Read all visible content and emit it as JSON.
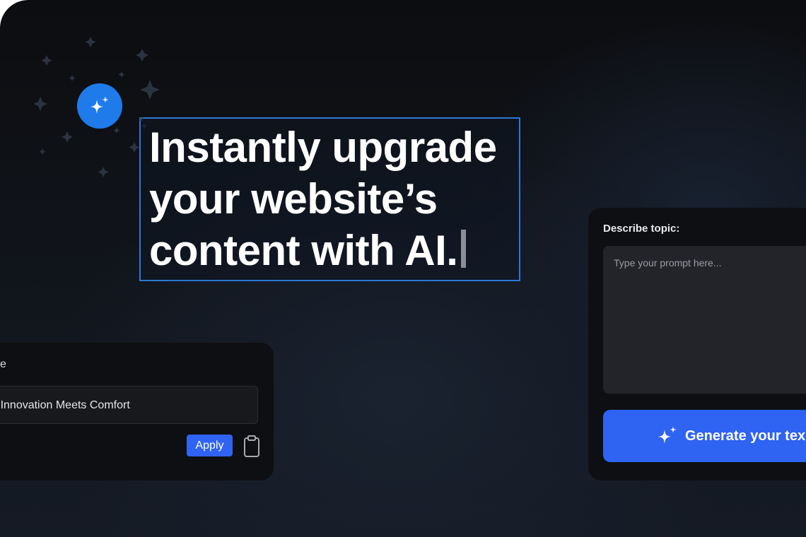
{
  "hero": {
    "headline_line1": "Instantly upgrade",
    "headline_line2": "your website’s",
    "headline_line3": "content with AI.",
    "badge_icon": "sparkles-icon"
  },
  "title_panel": {
    "label_fragment": "e",
    "title_value": "ere Innovation Meets Comfort",
    "apply_label": "Apply",
    "clipboard_icon": "clipboard-icon"
  },
  "prompt_panel": {
    "label": "Describe topic:",
    "placeholder": "Type your prompt here...",
    "generate_label": "Generate your tex",
    "generate_icon": "sparkles-icon"
  },
  "colors": {
    "accent_blue": "#2f63f2",
    "badge_blue": "#1f7be9",
    "selection_border": "#2b78d6"
  }
}
